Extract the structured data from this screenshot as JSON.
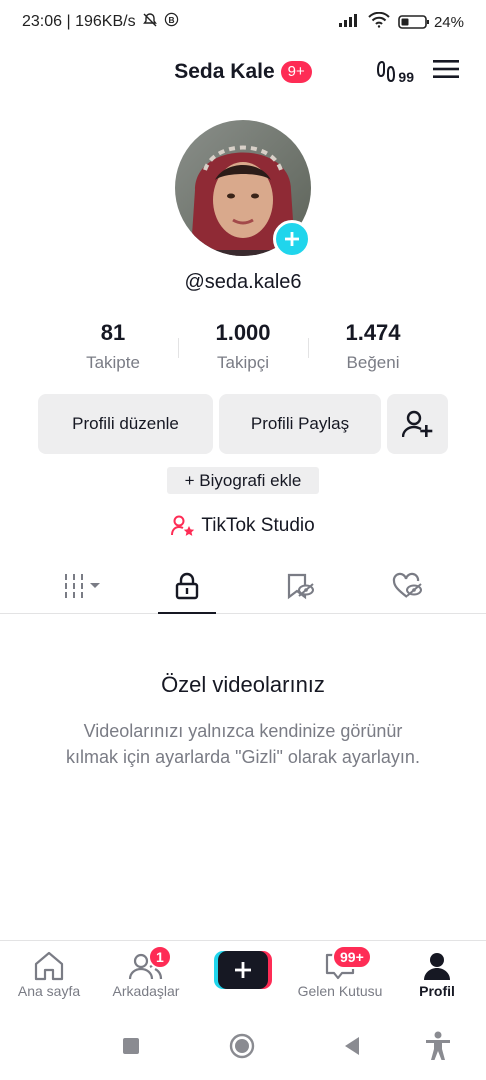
{
  "status_bar": {
    "time_speed": "23:06 | 196KB/s",
    "battery_pct": "24%"
  },
  "header": {
    "title": "Seda Kale",
    "notification_badge": "9+",
    "icon_right_label": "99"
  },
  "profile": {
    "handle": "@seda.kale6",
    "stats": [
      {
        "value": "81",
        "label": "Takipte"
      },
      {
        "value": "1.000",
        "label": "Takipçi"
      },
      {
        "value": "1.474",
        "label": "Beğeni"
      }
    ],
    "edit_button": "Profili düzenle",
    "share_button": "Profili Paylaş",
    "bio_button": "+ Biyografi ekle",
    "studio_link": "TikTok Studio"
  },
  "empty_state": {
    "title": "Özel videolarınız",
    "description": "Videolarınızı yalnızca kendinize görünür kılmak için ayarlarda \"Gizli\" olarak ayarlayın."
  },
  "bottom_nav": {
    "home": "Ana sayfa",
    "friends": "Arkadaşlar",
    "friends_badge": "1",
    "inbox": "Gelen Kutusu",
    "inbox_badge": "99+",
    "profile": "Profil"
  },
  "colors": {
    "accent": "#fe2c55",
    "cyan": "#20d5ec",
    "text_primary": "#161823",
    "text_secondary": "#7a7c85",
    "button_bg": "#eeeeef"
  }
}
